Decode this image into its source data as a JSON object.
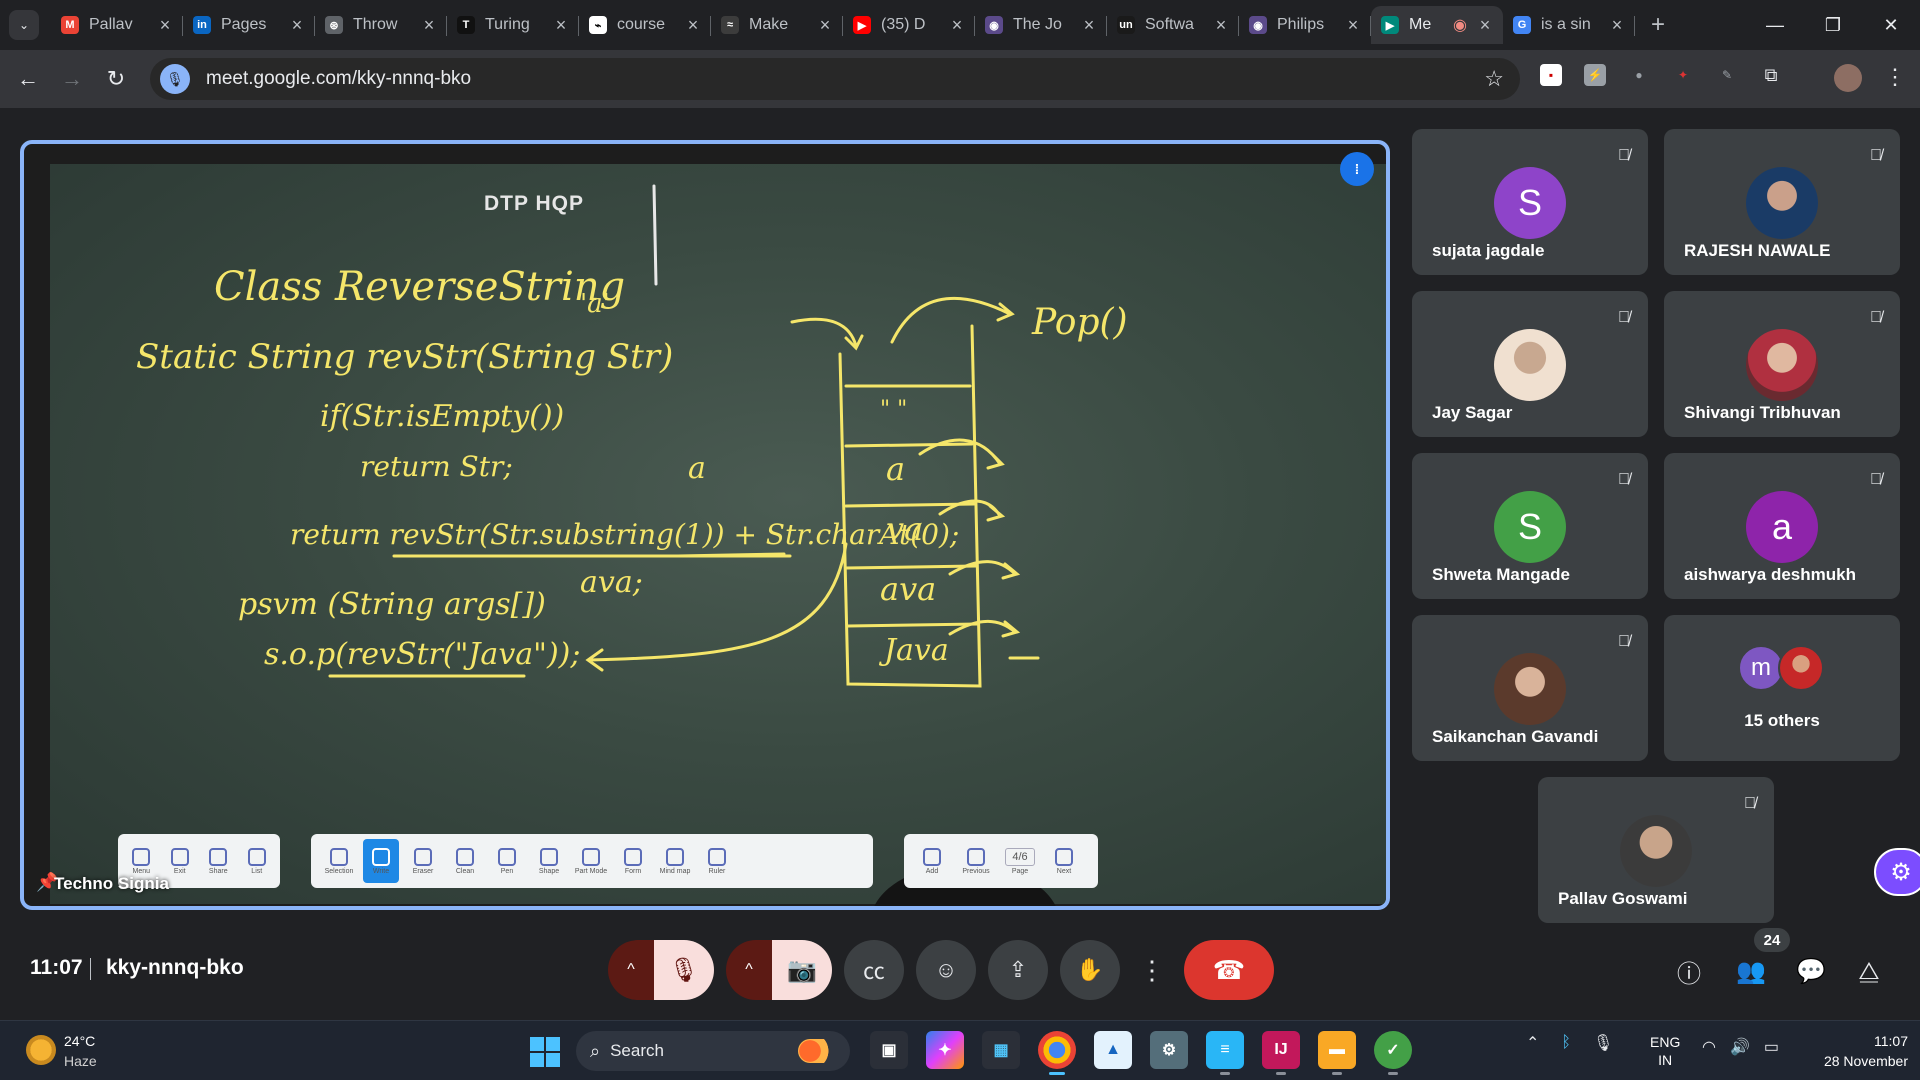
{
  "browser": {
    "tabs": [
      {
        "title": "Pallav",
        "icon": "gmail-icon",
        "color": "#ea4335",
        "glyph": "M"
      },
      {
        "title": "Pages",
        "icon": "linkedin-icon",
        "color": "#0a66c2",
        "glyph": "in"
      },
      {
        "title": "Throw",
        "icon": "openai-icon",
        "color": "#5f6368",
        "glyph": "⊛"
      },
      {
        "title": "Turing",
        "icon": "turing-icon",
        "color": "#111111",
        "glyph": "T"
      },
      {
        "title": "course",
        "icon": "notion-icon",
        "color": "#ffffff",
        "glyph": "⌁"
      },
      {
        "title": "Make",
        "icon": "make-icon",
        "color": "#3c3c3c",
        "glyph": "≈"
      },
      {
        "title": "(35) D",
        "icon": "youtube-icon",
        "color": "#ff0000",
        "glyph": "▶"
      },
      {
        "title": "The Jo",
        "icon": "the-jo-icon",
        "color": "#5b4a8a",
        "glyph": "◉"
      },
      {
        "title": "Softwa",
        "icon": "un-icon",
        "color": "#1a1a1a",
        "glyph": "un"
      },
      {
        "title": "Philips",
        "icon": "philips-icon",
        "color": "#5b4a8a",
        "glyph": "◉"
      },
      {
        "title": "Me",
        "icon": "google-meet-icon",
        "color": "#00897b",
        "glyph": "▶",
        "active": true,
        "recording": true
      },
      {
        "title": "is a sin",
        "icon": "google-icon",
        "color": "#4285f4",
        "glyph": "G"
      }
    ],
    "url": "meet.google.com/kky-nnnq-bko"
  },
  "board": {
    "label": "DTP HQP",
    "presenter": "Techno Signia",
    "page": "4/6",
    "toolbar_left": [
      "Menu",
      "Exit",
      "Share",
      "List"
    ],
    "toolbar_mid": [
      "Selection",
      "Write",
      "Eraser",
      "Clean",
      "Pen",
      "Shape",
      "Part Mode",
      "Form",
      "Mind map",
      "Ruler"
    ],
    "toolbar_right": [
      "Add",
      "Previous",
      "Page",
      "Next"
    ],
    "writing": {
      "title": "Class ReverseString",
      "line1": "Static String revStr(String Str)",
      "line2": "if(Str.isEmpty())",
      "line3": "return Str;",
      "line4": "return revStr(Str.substring(1)) + Str.charAt(0);",
      "line5": "psvm (String args[])",
      "line6": "s.o.p(revStr(\"Java\"));",
      "pop": "Pop()",
      "stack": [
        "\" \"",
        "a",
        "va",
        "ava",
        "Java"
      ],
      "notes": [
        "'a'",
        "a",
        "ava;"
      ]
    }
  },
  "participants": [
    {
      "name": "sujata jagdale",
      "initial": "S",
      "color": "#8e44c9",
      "muted": true
    },
    {
      "name": "RAJESH NAWALE",
      "photo": "photo4",
      "muted": true
    },
    {
      "name": "Jay Sagar",
      "photo": "photo5",
      "muted": true
    },
    {
      "name": "Shivangi Tribhuvan",
      "photo": "photo2",
      "muted": true
    },
    {
      "name": "Shweta Mangade",
      "initial": "S",
      "color": "#43a047",
      "muted": true
    },
    {
      "name": "aishwarya deshmukh",
      "initial": "a",
      "color": "#8e24aa",
      "muted": true
    },
    {
      "name": "Saikanchan Gavandi",
      "photo": "photo3",
      "muted": true
    },
    {
      "name": "Pallav Goswami",
      "photo": "photo",
      "muted": true
    }
  ],
  "others": {
    "label": "15 others",
    "initial": "m",
    "color": "#7e57c2"
  },
  "meet": {
    "time": "11:07",
    "code": "kky-nnnq-bko",
    "people_count": "24"
  },
  "taskbar": {
    "temp": "24°C",
    "condition": "Haze",
    "search": "Search",
    "lang_top": "ENG",
    "lang_bottom": "IN",
    "time": "11:07",
    "date": "28 November"
  }
}
